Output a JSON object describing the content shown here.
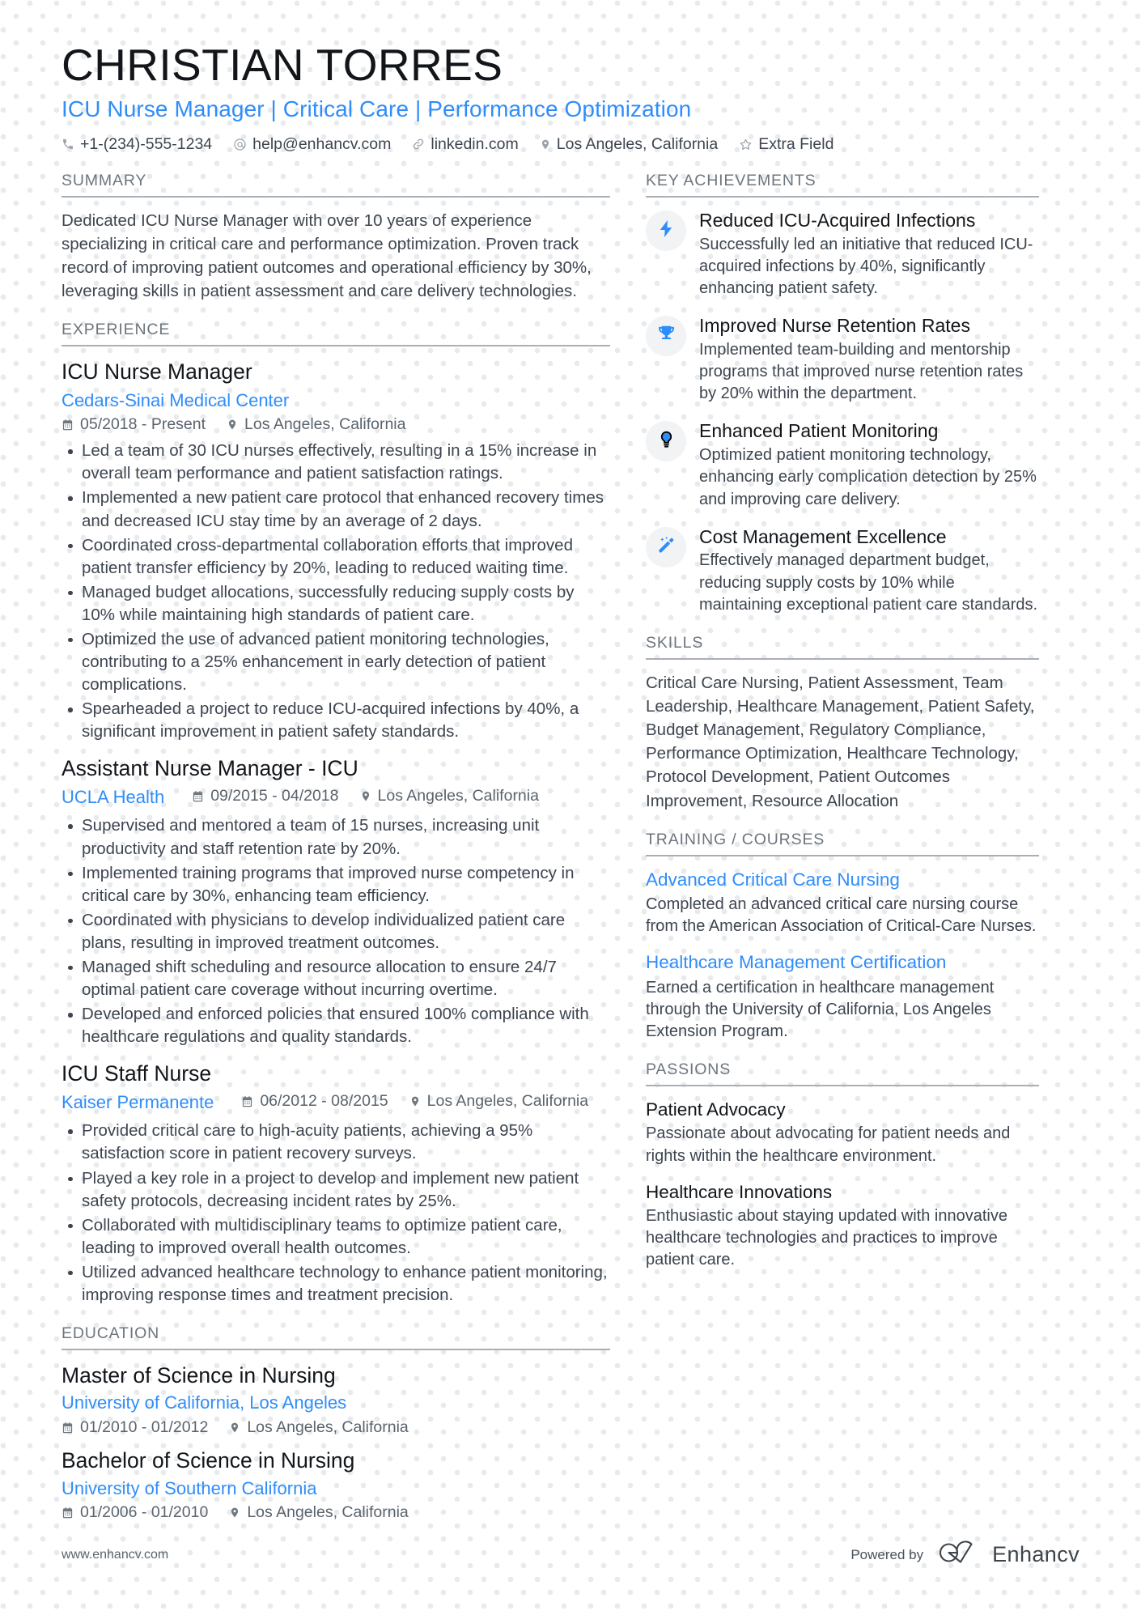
{
  "header": {
    "name": "CHRISTIAN TORRES",
    "headline": "ICU Nurse Manager | Critical Care | Performance Optimization",
    "contacts": [
      {
        "icon": "phone-icon",
        "text": "+1-(234)-555-1234"
      },
      {
        "icon": "email-icon",
        "text": "help@enhancv.com"
      },
      {
        "icon": "link-icon",
        "text": "linkedin.com"
      },
      {
        "icon": "location-icon",
        "text": "Los Angeles, California"
      },
      {
        "icon": "star-icon",
        "text": "Extra Field"
      }
    ]
  },
  "summary": {
    "heading": "SUMMARY",
    "text": "Dedicated ICU Nurse Manager with over 10 years of experience specializing in critical care and performance optimization. Proven track record of improving patient outcomes and operational efficiency by 30%, leveraging skills in patient assessment and care delivery technologies."
  },
  "experience": {
    "heading": "EXPERIENCE",
    "jobs": [
      {
        "title": "ICU Nurse Manager",
        "company": "Cedars-Sinai Medical Center",
        "dates": "05/2018 - Present",
        "location": "Los Angeles, California",
        "inline_meta": false,
        "bullets": [
          "Led a team of 30 ICU nurses effectively, resulting in a 15% increase in overall team performance and patient satisfaction ratings.",
          "Implemented a new patient care protocol that enhanced recovery times and decreased ICU stay time by an average of 2 days.",
          "Coordinated cross-departmental collaboration efforts that improved patient transfer efficiency by 20%, leading to reduced waiting time.",
          "Managed budget allocations, successfully reducing supply costs by 10% while maintaining high standards of patient care.",
          "Optimized the use of advanced patient monitoring technologies, contributing to a 25% enhancement in early detection of patient complications.",
          "Spearheaded a project to reduce ICU-acquired infections by 40%, a significant improvement in patient safety standards."
        ]
      },
      {
        "title": "Assistant Nurse Manager - ICU",
        "company": "UCLA Health",
        "dates": "09/2015 - 04/2018",
        "location": "Los Angeles, California",
        "inline_meta": true,
        "bullets": [
          "Supervised and mentored a team of 15 nurses, increasing unit productivity and staff retention rate by 20%.",
          "Implemented training programs that improved nurse competency in critical care by 30%, enhancing team efficiency.",
          "Coordinated with physicians to develop individualized patient care plans, resulting in improved treatment outcomes.",
          "Managed shift scheduling and resource allocation to ensure 24/7 optimal patient care coverage without incurring overtime.",
          "Developed and enforced policies that ensured 100% compliance with healthcare regulations and quality standards."
        ]
      },
      {
        "title": "ICU Staff Nurse",
        "company": "Kaiser Permanente",
        "dates": "06/2012 - 08/2015",
        "location": "Los Angeles, California",
        "inline_meta": true,
        "bullets": [
          "Provided critical care to high-acuity patients, achieving a 95% satisfaction score in patient recovery surveys.",
          "Played a key role in a project to develop and implement new patient safety protocols, decreasing incident rates by 25%.",
          "Collaborated with multidisciplinary teams to optimize patient care, leading to improved overall health outcomes.",
          "Utilized advanced healthcare technology to enhance patient monitoring, improving response times and treatment precision."
        ]
      }
    ]
  },
  "education": {
    "heading": "EDUCATION",
    "items": [
      {
        "degree": "Master of Science in Nursing",
        "school": "University of California, Los Angeles",
        "dates": "01/2010 - 01/2012",
        "location": "Los Angeles, California"
      },
      {
        "degree": "Bachelor of Science in Nursing",
        "school": "University of Southern California",
        "dates": "01/2006 - 01/2010",
        "location": "Los Angeles, California"
      }
    ]
  },
  "achievements": {
    "heading": "KEY ACHIEVEMENTS",
    "items": [
      {
        "icon": "bolt-icon",
        "title": "Reduced ICU-Acquired Infections",
        "desc": "Successfully led an initiative that reduced ICU-acquired infections by 40%, significantly enhancing patient safety."
      },
      {
        "icon": "trophy-icon",
        "title": "Improved Nurse Retention Rates",
        "desc": "Implemented team-building and mentorship programs that improved nurse retention rates by 20% within the department."
      },
      {
        "icon": "lightbulb-icon",
        "title": "Enhanced Patient Monitoring",
        "desc": "Optimized patient monitoring technology, enhancing early complication detection by 25% and improving care delivery."
      },
      {
        "icon": "magic-wand-icon",
        "title": "Cost Management Excellence",
        "desc": "Effectively managed department budget, reducing supply costs by 10% while maintaining exceptional patient care standards."
      }
    ]
  },
  "skills": {
    "heading": "SKILLS",
    "text": "Critical Care Nursing, Patient Assessment, Team Leadership, Healthcare Management, Patient Safety, Budget Management, Regulatory Compliance, Performance Optimization, Healthcare Technology, Protocol Development, Patient Outcomes Improvement, Resource Allocation"
  },
  "training": {
    "heading": "TRAINING / COURSES",
    "items": [
      {
        "title": "Advanced Critical Care Nursing",
        "desc": "Completed an advanced critical care nursing course from the American Association of Critical-Care Nurses."
      },
      {
        "title": "Healthcare Management Certification",
        "desc": "Earned a certification in healthcare management through the University of California, Los Angeles Extension Program."
      }
    ]
  },
  "passions": {
    "heading": "PASSIONS",
    "items": [
      {
        "title": "Patient Advocacy",
        "desc": "Passionate about advocating for patient needs and rights within the healthcare environment."
      },
      {
        "title": "Healthcare Innovations",
        "desc": "Enthusiastic about staying updated with innovative healthcare technologies and practices to improve patient care."
      }
    ]
  },
  "footer": {
    "url": "www.enhancv.com",
    "powered_by": "Powered by",
    "brand": "Enhancv"
  },
  "colors": {
    "accent": "#2f8dfa",
    "text": "#3d4550",
    "heading": "#12161a",
    "section_label": "#6d757e"
  }
}
